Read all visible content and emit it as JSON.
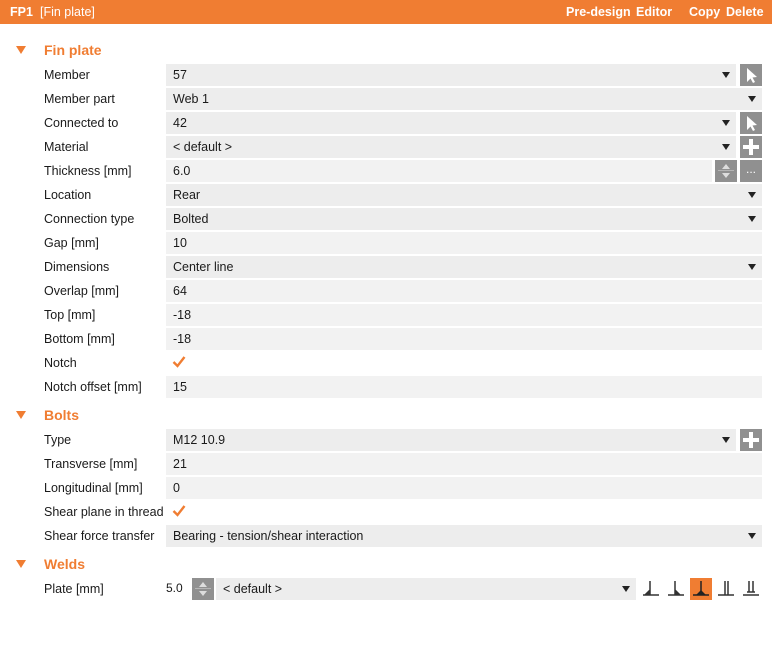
{
  "header": {
    "id": "FP1",
    "name": "[Fin plate]",
    "actions": [
      "Pre-design",
      "Editor",
      "Copy",
      "Delete"
    ]
  },
  "fin_plate": {
    "title": "Fin plate",
    "member": {
      "label": "Member",
      "value": "57"
    },
    "member_part": {
      "label": "Member part",
      "value": "Web 1"
    },
    "connected_to": {
      "label": "Connected to",
      "value": "42"
    },
    "material": {
      "label": "Material",
      "value": "< default >"
    },
    "thickness": {
      "label": "Thickness [mm]",
      "value": "6.0",
      "more": "..."
    },
    "location": {
      "label": "Location",
      "value": "Rear"
    },
    "connection_type": {
      "label": "Connection type",
      "value": "Bolted"
    },
    "gap": {
      "label": "Gap [mm]",
      "value": "10"
    },
    "dimensions": {
      "label": "Dimensions",
      "value": "Center line"
    },
    "overlap": {
      "label": "Overlap [mm]",
      "value": "64"
    },
    "top": {
      "label": "Top [mm]",
      "value": "-18"
    },
    "bottom": {
      "label": "Bottom [mm]",
      "value": "-18"
    },
    "notch": {
      "label": "Notch",
      "checked": true
    },
    "notch_offset": {
      "label": "Notch offset [mm]",
      "value": "15"
    }
  },
  "bolts": {
    "title": "Bolts",
    "type": {
      "label": "Type",
      "value": "M12 10.9"
    },
    "transverse": {
      "label": "Transverse [mm]",
      "value": "21"
    },
    "longitudinal": {
      "label": "Longitudinal [mm]",
      "value": "0"
    },
    "shear_plane": {
      "label": "Shear plane in thread",
      "checked": true
    },
    "shear_force_transfer": {
      "label": "Shear force transfer",
      "value": "Bearing - tension/shear interaction"
    }
  },
  "welds": {
    "title": "Welds",
    "plate": {
      "label": "Plate [mm]",
      "size": "5.0",
      "material": "< default >"
    },
    "weld_types": [
      "fillet-weld-icon",
      "double-fillet-weld-icon",
      "both-sided-fillet-weld-icon",
      "butt-weld-icon",
      "partial-butt-weld-icon"
    ],
    "active_weld_type": 2
  },
  "colors": {
    "accent": "#f07d32",
    "field": "#ededed",
    "button": "#909090"
  }
}
